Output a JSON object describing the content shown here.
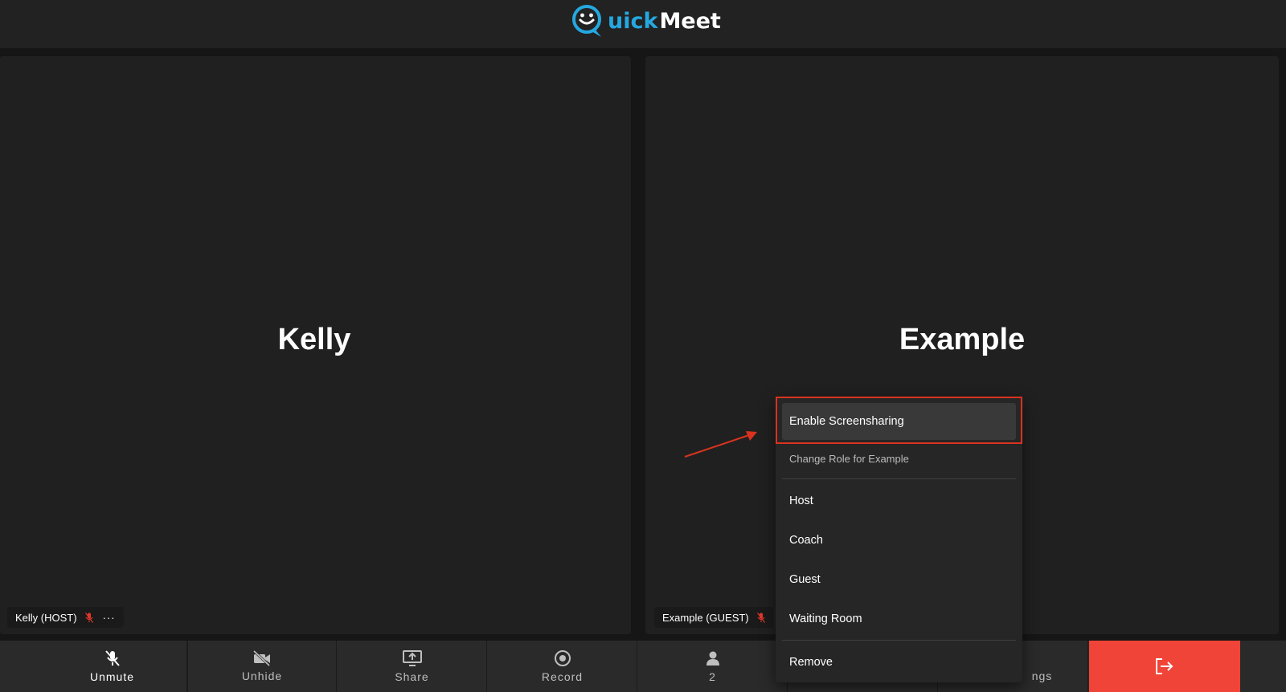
{
  "header": {
    "logo_part1": "uick",
    "logo_part2": "Meet"
  },
  "tiles": [
    {
      "name": "Kelly",
      "chip_label": "Kelly (HOST)",
      "more_label": "···",
      "mic": "mic-off-icon"
    },
    {
      "name": "Example",
      "chip_label": "Example (GUEST)",
      "mic": "mic-off-icon"
    }
  ],
  "toolbar": {
    "unmute_label": "Unmute",
    "unhide_label": "Unhide",
    "share_label": "Share",
    "record_label": "Record",
    "participants_count": "2",
    "settings_label_visible": "ngs"
  },
  "context_menu": {
    "enable_screensharing": "Enable Screensharing",
    "change_role_header": "Change Role for Example",
    "roles": [
      "Host",
      "Coach",
      "Guest",
      "Waiting Room"
    ],
    "remove": "Remove"
  },
  "colors": {
    "accent_blue": "#25a8e0",
    "leave_red": "#f04438",
    "mute_red": "#e0362c",
    "callout_red": "#d9331f"
  }
}
